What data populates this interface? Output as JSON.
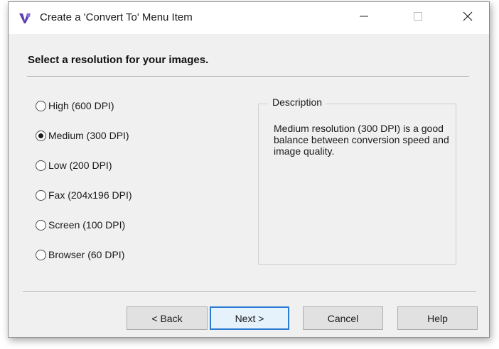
{
  "window": {
    "title": "Create a 'Convert To' Menu Item",
    "icon": "app-logo-icon",
    "controls": [
      "minimize-icon",
      "maximize-icon",
      "close-icon"
    ]
  },
  "heading": "Select a resolution for your images.",
  "resolutions": [
    {
      "label": "High (600 DPI)",
      "checked": false
    },
    {
      "label": "Medium (300 DPI)",
      "checked": true
    },
    {
      "label": "Low (200 DPI)",
      "checked": false
    },
    {
      "label": "Fax (204x196 DPI)",
      "checked": false
    },
    {
      "label": "Screen (100 DPI)",
      "checked": false
    },
    {
      "label": "Browser (60 DPI)",
      "checked": false
    }
  ],
  "description": {
    "title": "Description",
    "text": "Medium resolution (300 DPI) is a good balance between conversion speed and image quality."
  },
  "buttons": {
    "back": "< Back",
    "next": "Next >",
    "cancel": "Cancel",
    "help": "Help"
  },
  "colors": {
    "accent": "#2b7ad3",
    "dialog_bg": "#f0f0f0"
  }
}
